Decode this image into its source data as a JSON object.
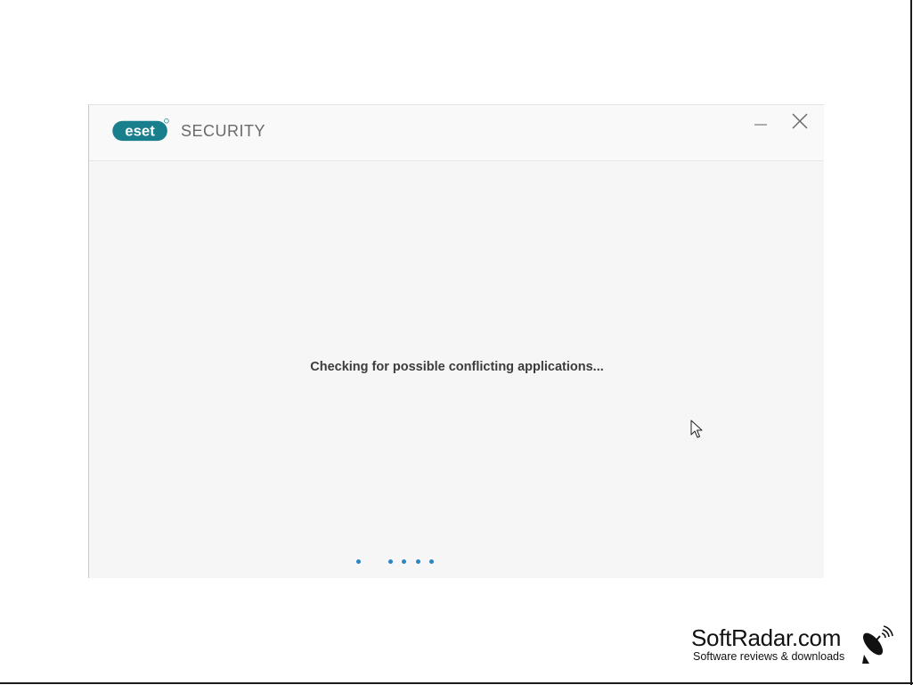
{
  "window": {
    "brand": "eset",
    "product": "SECURITY",
    "status_text": "Checking for possible conflicting applications...",
    "controls": {
      "minimize_icon": "minimize-icon",
      "close_icon": "close-icon"
    },
    "progress_dots": 5,
    "colors": {
      "brand_teal": "#1a7f8c",
      "dot_blue": "#2a86c6",
      "background": "#f6f6f6"
    }
  },
  "watermark": {
    "title": "SoftRadar.com",
    "subtitle": "Software reviews & downloads",
    "icon": "satellite-dish-icon"
  }
}
